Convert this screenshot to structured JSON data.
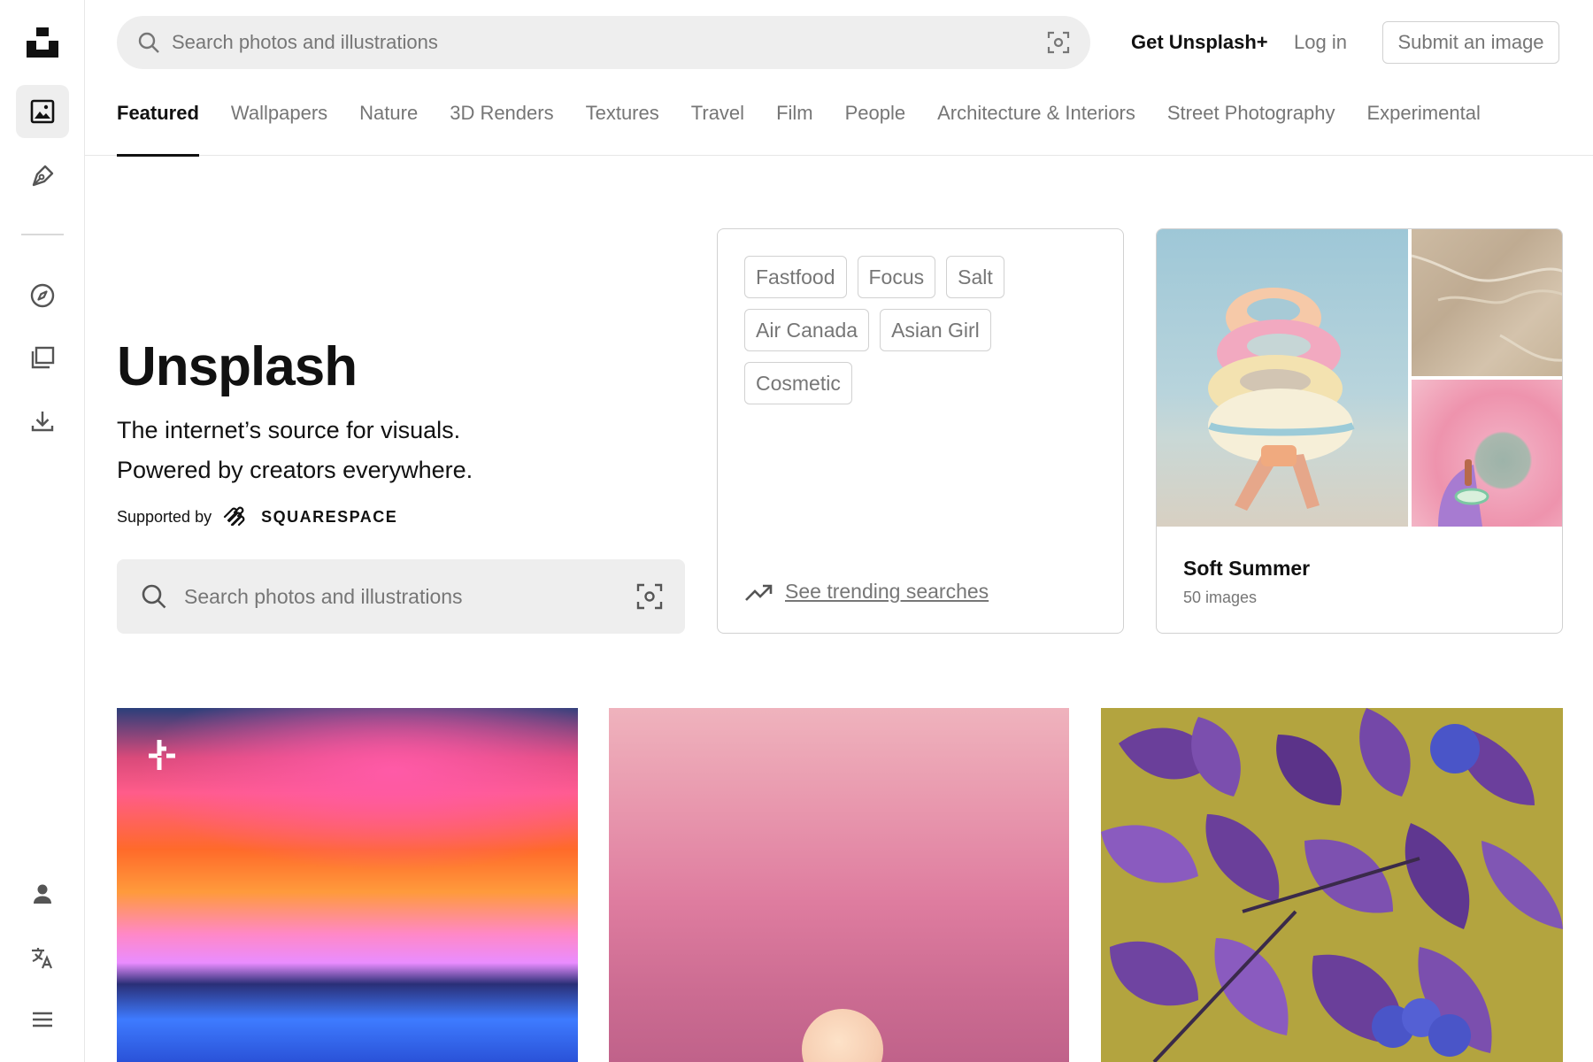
{
  "header": {
    "search_placeholder": "Search photos and illustrations",
    "get_plus_label": "Get Unsplash+",
    "login_label": "Log in",
    "submit_label": "Submit an image"
  },
  "topics": [
    {
      "label": "Featured",
      "active": true
    },
    {
      "label": "Wallpapers"
    },
    {
      "label": "Nature"
    },
    {
      "label": "3D Renders"
    },
    {
      "label": "Textures"
    },
    {
      "label": "Travel"
    },
    {
      "label": "Film"
    },
    {
      "label": "People"
    },
    {
      "label": "Architecture & Interiors"
    },
    {
      "label": "Street Photography"
    },
    {
      "label": "Experimental"
    }
  ],
  "sidebar": {
    "items": [
      {
        "icon": "unsplash-logo-icon"
      },
      {
        "icon": "photos-icon",
        "active": true
      },
      {
        "icon": "illustrations-pen-icon"
      },
      {
        "icon": "explore-compass-icon"
      },
      {
        "icon": "collections-icon"
      },
      {
        "icon": "download-icon"
      },
      {
        "icon": "user-icon"
      },
      {
        "icon": "language-translate-icon"
      },
      {
        "icon": "menu-icon"
      }
    ]
  },
  "hero": {
    "title": "Unsplash",
    "line1": "The internet’s source for visuals.",
    "line2": "Powered by creators everywhere.",
    "supported_by": "Supported by",
    "sponsor": "SQUARESPACE",
    "search_placeholder": "Search photos and illustrations"
  },
  "trending": {
    "chips": [
      "Fastfood",
      "Focus",
      "Salt",
      "Air Canada",
      "Asian Girl",
      "Cosmetic"
    ],
    "link_label": "See trending searches"
  },
  "collection": {
    "name": "Soft Summer",
    "count": "50 images"
  },
  "colors": {
    "text_primary": "#111111",
    "text_secondary": "#767676",
    "border": "#d1d1d1",
    "search_bg": "#eeeeee"
  }
}
